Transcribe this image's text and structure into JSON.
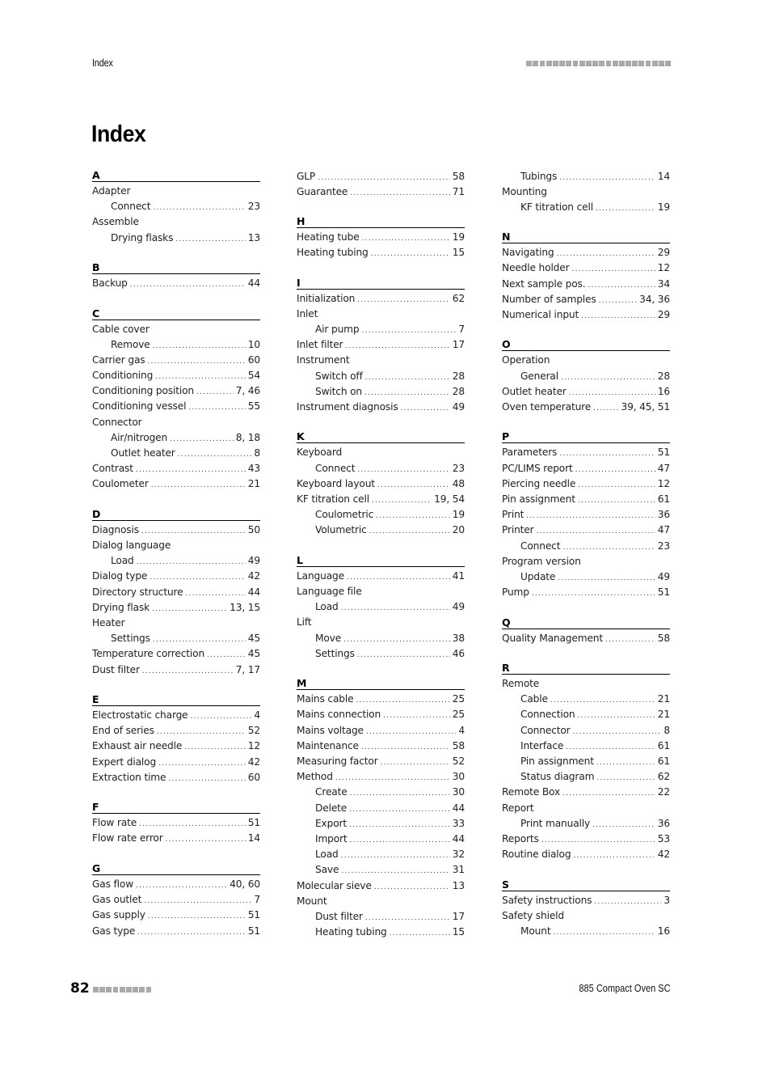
{
  "header": {
    "section_title": "Index",
    "decoration_squares": 22
  },
  "page_title": "Index",
  "footer": {
    "page_number": "82",
    "decoration_squares": 9,
    "document_title": "885 Compact Oven SC"
  },
  "columns": [
    {
      "groups": [
        {
          "letter": "A",
          "entries": [
            {
              "term": "Adapter",
              "pages": "",
              "level": 0
            },
            {
              "term": "Connect",
              "pages": "23",
              "level": 1
            },
            {
              "term": "Assemble",
              "pages": "",
              "level": 0
            },
            {
              "term": "Drying flasks",
              "pages": "13",
              "level": 1
            }
          ]
        },
        {
          "letter": "B",
          "entries": [
            {
              "term": "Backup",
              "pages": "44",
              "level": 0
            }
          ]
        },
        {
          "letter": "C",
          "entries": [
            {
              "term": "Cable cover",
              "pages": "",
              "level": 0
            },
            {
              "term": "Remove",
              "pages": "10",
              "level": 1
            },
            {
              "term": "Carrier gas",
              "pages": "60",
              "level": 0
            },
            {
              "term": "Conditioning",
              "pages": "54",
              "level": 0
            },
            {
              "term": "Conditioning position",
              "pages": "7, 46",
              "level": 0
            },
            {
              "term": "Conditioning vessel",
              "pages": "55",
              "level": 0
            },
            {
              "term": "Connector",
              "pages": "",
              "level": 0
            },
            {
              "term": "Air/nitrogen",
              "pages": "8, 18",
              "level": 1
            },
            {
              "term": "Outlet heater",
              "pages": "8",
              "level": 1
            },
            {
              "term": "Contrast",
              "pages": "43",
              "level": 0
            },
            {
              "term": "Coulometer",
              "pages": "21",
              "level": 0
            }
          ]
        },
        {
          "letter": "D",
          "entries": [
            {
              "term": "Diagnosis",
              "pages": "50",
              "level": 0
            },
            {
              "term": "Dialog language",
              "pages": "",
              "level": 0
            },
            {
              "term": "Load",
              "pages": "49",
              "level": 1
            },
            {
              "term": "Dialog type",
              "pages": "42",
              "level": 0
            },
            {
              "term": "Directory structure",
              "pages": "44",
              "level": 0
            },
            {
              "term": "Drying flask",
              "pages": "13, 15",
              "level": 0
            },
            {
              "term": "Heater",
              "pages": "",
              "level": 0
            },
            {
              "term": "Settings",
              "pages": "45",
              "level": 1
            },
            {
              "term": "Temperature correction",
              "pages": "45",
              "level": 0
            },
            {
              "term": "Dust filter",
              "pages": "7, 17",
              "level": 0
            }
          ]
        },
        {
          "letter": "E",
          "entries": [
            {
              "term": "Electrostatic charge",
              "pages": "4",
              "level": 0
            },
            {
              "term": "End of series",
              "pages": "52",
              "level": 0
            },
            {
              "term": "Exhaust air needle",
              "pages": "12",
              "level": 0
            },
            {
              "term": "Expert dialog",
              "pages": "42",
              "level": 0
            },
            {
              "term": "Extraction time",
              "pages": "60",
              "level": 0
            }
          ]
        },
        {
          "letter": "F",
          "entries": [
            {
              "term": "Flow rate",
              "pages": "51",
              "level": 0
            },
            {
              "term": "Flow rate error",
              "pages": "14",
              "level": 0
            }
          ]
        },
        {
          "letter": "G",
          "entries": [
            {
              "term": "Gas flow",
              "pages": "40, 60",
              "level": 0
            },
            {
              "term": "Gas outlet",
              "pages": "7",
              "level": 0
            },
            {
              "term": "Gas supply",
              "pages": "51",
              "level": 0
            },
            {
              "term": "Gas type",
              "pages": "51",
              "level": 0
            }
          ]
        }
      ]
    },
    {
      "groups": [
        {
          "letter": "",
          "entries": [
            {
              "term": "GLP",
              "pages": "58",
              "level": 0
            },
            {
              "term": "Guarantee",
              "pages": "71",
              "level": 0
            }
          ]
        },
        {
          "letter": "H",
          "entries": [
            {
              "term": "Heating tube",
              "pages": "19",
              "level": 0
            },
            {
              "term": "Heating tubing",
              "pages": "15",
              "level": 0
            }
          ]
        },
        {
          "letter": "I",
          "entries": [
            {
              "term": "Initialization",
              "pages": "62",
              "level": 0
            },
            {
              "term": "Inlet",
              "pages": "",
              "level": 0
            },
            {
              "term": "Air pump",
              "pages": "7",
              "level": 1
            },
            {
              "term": "Inlet filter",
              "pages": "17",
              "level": 0
            },
            {
              "term": "Instrument",
              "pages": "",
              "level": 0
            },
            {
              "term": "Switch off",
              "pages": "28",
              "level": 1
            },
            {
              "term": "Switch on",
              "pages": "28",
              "level": 1
            },
            {
              "term": "Instrument diagnosis",
              "pages": "49",
              "level": 0
            }
          ]
        },
        {
          "letter": "K",
          "entries": [
            {
              "term": "Keyboard",
              "pages": "",
              "level": 0
            },
            {
              "term": "Connect",
              "pages": "23",
              "level": 1
            },
            {
              "term": "Keyboard layout",
              "pages": "48",
              "level": 0
            },
            {
              "term": "KF titration cell",
              "pages": "19, 54",
              "level": 0
            },
            {
              "term": "Coulometric",
              "pages": "19",
              "level": 1
            },
            {
              "term": "Volumetric",
              "pages": "20",
              "level": 1
            }
          ]
        },
        {
          "letter": "L",
          "entries": [
            {
              "term": "Language",
              "pages": "41",
              "level": 0
            },
            {
              "term": "Language file",
              "pages": "",
              "level": 0
            },
            {
              "term": "Load",
              "pages": "49",
              "level": 1
            },
            {
              "term": "Lift",
              "pages": "",
              "level": 0
            },
            {
              "term": "Move",
              "pages": "38",
              "level": 1
            },
            {
              "term": "Settings",
              "pages": "46",
              "level": 1
            }
          ]
        },
        {
          "letter": "M",
          "entries": [
            {
              "term": "Mains cable",
              "pages": "25",
              "level": 0
            },
            {
              "term": "Mains connection",
              "pages": "25",
              "level": 0
            },
            {
              "term": "Mains voltage",
              "pages": "4",
              "level": 0
            },
            {
              "term": "Maintenance",
              "pages": "58",
              "level": 0
            },
            {
              "term": "Measuring factor",
              "pages": "52",
              "level": 0
            },
            {
              "term": "Method",
              "pages": "30",
              "level": 0
            },
            {
              "term": "Create",
              "pages": "30",
              "level": 1
            },
            {
              "term": "Delete",
              "pages": "44",
              "level": 1
            },
            {
              "term": "Export",
              "pages": "33",
              "level": 1
            },
            {
              "term": "Import",
              "pages": "44",
              "level": 1
            },
            {
              "term": "Load",
              "pages": "32",
              "level": 1
            },
            {
              "term": "Save",
              "pages": "31",
              "level": 1
            },
            {
              "term": "Molecular sieve",
              "pages": "13",
              "level": 0
            },
            {
              "term": "Mount",
              "pages": "",
              "level": 0
            },
            {
              "term": "Dust filter",
              "pages": "17",
              "level": 1
            },
            {
              "term": "Heating tubing",
              "pages": "15",
              "level": 1
            }
          ]
        }
      ]
    },
    {
      "groups": [
        {
          "letter": "",
          "entries": [
            {
              "term": "Tubings",
              "pages": "14",
              "level": 1
            },
            {
              "term": "Mounting",
              "pages": "",
              "level": 0
            },
            {
              "term": "KF titration cell",
              "pages": "19",
              "level": 1
            }
          ]
        },
        {
          "letter": "N",
          "entries": [
            {
              "term": "Navigating",
              "pages": "29",
              "level": 0
            },
            {
              "term": "Needle holder",
              "pages": "12",
              "level": 0
            },
            {
              "term": "Next sample pos.",
              "pages": "34",
              "level": 0
            },
            {
              "term": "Number of samples",
              "pages": "34, 36",
              "level": 0
            },
            {
              "term": "Numerical input",
              "pages": "29",
              "level": 0
            }
          ]
        },
        {
          "letter": "O",
          "entries": [
            {
              "term": "Operation",
              "pages": "",
              "level": 0
            },
            {
              "term": "General",
              "pages": "28",
              "level": 1
            },
            {
              "term": "Outlet heater",
              "pages": "16",
              "level": 0
            },
            {
              "term": "Oven temperature",
              "pages": "39, 45, 51",
              "level": 0
            }
          ]
        },
        {
          "letter": "P",
          "entries": [
            {
              "term": "Parameters",
              "pages": "51",
              "level": 0
            },
            {
              "term": "PC/LIMS report",
              "pages": "47",
              "level": 0
            },
            {
              "term": "Piercing needle",
              "pages": "12",
              "level": 0
            },
            {
              "term": "Pin assignment",
              "pages": "61",
              "level": 0
            },
            {
              "term": "Print",
              "pages": "36",
              "level": 0
            },
            {
              "term": "Printer",
              "pages": "47",
              "level": 0
            },
            {
              "term": "Connect",
              "pages": "23",
              "level": 1
            },
            {
              "term": "Program version",
              "pages": "",
              "level": 0
            },
            {
              "term": "Update",
              "pages": "49",
              "level": 1
            },
            {
              "term": "Pump",
              "pages": "51",
              "level": 0
            }
          ]
        },
        {
          "letter": "Q",
          "entries": [
            {
              "term": "Quality Management",
              "pages": "58",
              "level": 0
            }
          ]
        },
        {
          "letter": "R",
          "entries": [
            {
              "term": "Remote",
              "pages": "",
              "level": 0
            },
            {
              "term": "Cable",
              "pages": "21",
              "level": 1
            },
            {
              "term": "Connection",
              "pages": "21",
              "level": 1
            },
            {
              "term": "Connector",
              "pages": "8",
              "level": 1
            },
            {
              "term": "Interface",
              "pages": "61",
              "level": 1
            },
            {
              "term": "Pin assignment",
              "pages": "61",
              "level": 1
            },
            {
              "term": "Status diagram",
              "pages": "62",
              "level": 1
            },
            {
              "term": "Remote Box",
              "pages": "22",
              "level": 0
            },
            {
              "term": "Report",
              "pages": "",
              "level": 0
            },
            {
              "term": "Print manually",
              "pages": "36",
              "level": 1
            },
            {
              "term": "Reports",
              "pages": "53",
              "level": 0
            },
            {
              "term": "Routine dialog",
              "pages": "42",
              "level": 0
            }
          ]
        },
        {
          "letter": "S",
          "entries": [
            {
              "term": "Safety instructions",
              "pages": "3",
              "level": 0
            },
            {
              "term": "Safety shield",
              "pages": "",
              "level": 0
            },
            {
              "term": "Mount",
              "pages": "16",
              "level": 1
            }
          ]
        }
      ]
    }
  ]
}
